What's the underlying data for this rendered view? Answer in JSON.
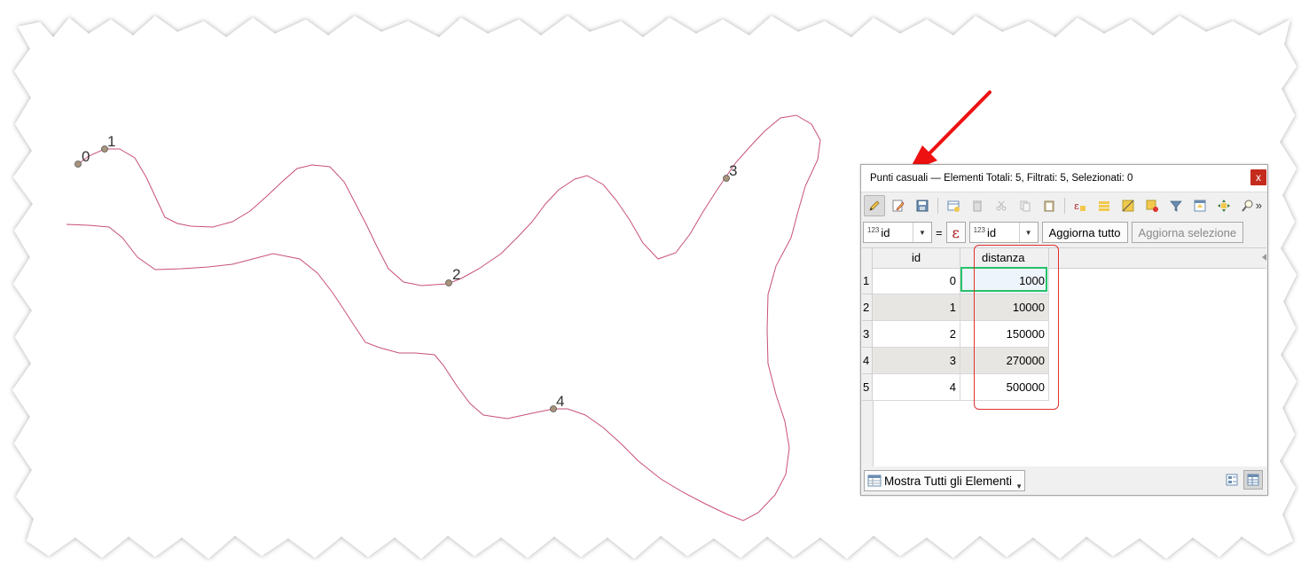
{
  "map": {
    "points": [
      {
        "label": "0"
      },
      {
        "label": "1"
      },
      {
        "label": "2"
      },
      {
        "label": "3"
      },
      {
        "label": "4"
      }
    ],
    "line_color": "#c8507a",
    "point_color": "#a8927a"
  },
  "window": {
    "title": "Punti casuali — Elementi Totali: 5,  Filtrati: 5, Selezionati: 0",
    "close_label": "x"
  },
  "toolbar": {
    "icons": [
      "pencil-icon",
      "edit-multiple-icon",
      "save-icon",
      "new-field-icon",
      "delete-icon",
      "cut-icon",
      "copy-icon",
      "paste-icon",
      "expression-select-icon",
      "select-all-icon",
      "invert-selection-icon",
      "deselect-icon",
      "filter-icon",
      "move-top-icon",
      "pan-to-icon",
      "zoom-to-icon"
    ],
    "more_label": "»"
  },
  "filter": {
    "field_prefix": "123",
    "field_value": "id",
    "equals": "=",
    "epsilon": "ε",
    "target_prefix": "123",
    "target_value": "id",
    "update_all": "Aggiorna tutto",
    "update_selection": "Aggiorna selezione"
  },
  "table": {
    "columns": [
      "id",
      "distanza"
    ],
    "rows": [
      {
        "n": "1",
        "id": "0",
        "distanza": "1000"
      },
      {
        "n": "2",
        "id": "1",
        "distanza": "10000"
      },
      {
        "n": "3",
        "id": "2",
        "distanza": "150000"
      },
      {
        "n": "4",
        "id": "3",
        "distanza": "270000"
      },
      {
        "n": "5",
        "id": "4",
        "distanza": "500000"
      }
    ]
  },
  "status": {
    "show_all": "Mostra Tutti gli Elementi"
  },
  "annotation": {
    "arrow_color": "#ee1111",
    "highlight_color": "#e23030",
    "selection_color": "#27c26a"
  }
}
